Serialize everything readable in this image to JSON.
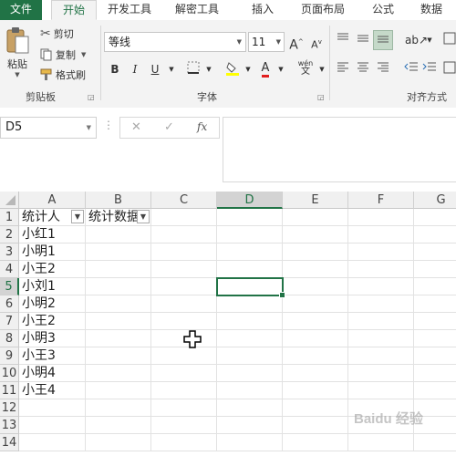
{
  "tabs": [
    "文件",
    "开始",
    "开发工具",
    "解密工具",
    "插入",
    "页面布局",
    "公式",
    "数据"
  ],
  "clipboard": {
    "paste": "粘贴",
    "cut": "剪切",
    "copy": "复制",
    "format_painter": "格式刷",
    "group_label": "剪贴板"
  },
  "font": {
    "name": "等线",
    "size": "11",
    "bold": "B",
    "italic": "I",
    "underline": "U",
    "phonetic": "wén",
    "group_label": "字体"
  },
  "alignment": {
    "group_label": "对齐方式"
  },
  "name_box": "D5",
  "formula_icons": {
    "cancel": "✕",
    "enter": "✓",
    "fx": "fx"
  },
  "formula_value": "",
  "columns": [
    "A",
    "B",
    "C",
    "D",
    "E",
    "F",
    "G"
  ],
  "rows": [
    "1",
    "2",
    "3",
    "4",
    "5",
    "6",
    "7",
    "8",
    "9",
    "10",
    "11",
    "12",
    "13",
    "14"
  ],
  "cells": {
    "A": [
      "统计人",
      "小红1",
      "小明1",
      "小王2",
      "小刘1",
      "小明2",
      "小王2",
      "小明3",
      "小王3",
      "小明4",
      "小王4",
      "",
      "",
      ""
    ],
    "B1": "统计数据"
  },
  "selected_cell": "D5",
  "accent_color": "#217346",
  "watermark": "Baidu 经验"
}
